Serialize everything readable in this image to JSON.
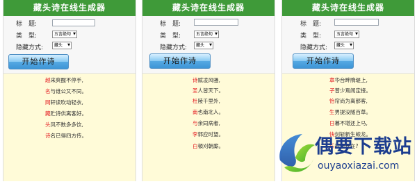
{
  "app_title": "藏头诗在线生成器",
  "form": {
    "title_label": "标　题:",
    "type_label": "类　型:",
    "hide_label": "隐藏方式:",
    "type_value": "五言绝句",
    "hide_value": "藏头",
    "submit_label": "开始作诗"
  },
  "panels": [
    {
      "lines": [
        {
          "head": "越",
          "rest": "来爽醒不停手,"
        },
        {
          "head": "名",
          "rest": "与谁公又不同。"
        },
        {
          "head": "网",
          "rest": "轩读吹动轻衣,"
        },
        {
          "head": "藏",
          "rest": "贮诗供离客好。"
        },
        {
          "head": "头",
          "rest": "风不数多多饮,"
        },
        {
          "head": "诗",
          "rest": "名已得四方传。"
        }
      ]
    },
    {
      "lines": [
        {
          "head": "诗",
          "rest": "赋凌风骚,"
        },
        {
          "head": "圣",
          "rest": "人皆天下。"
        },
        {
          "head": "杜",
          "rest": "陵千里外,"
        },
        {
          "head": "南",
          "rest": "也南北人。"
        },
        {
          "head": "与",
          "rest": "余同病者,"
        },
        {
          "head": "李",
          "rest": "郭应时望。"
        },
        {
          "head": "白",
          "rest": "頓刈朝廝。"
        }
      ]
    },
    {
      "lines": [
        {
          "head": "章",
          "rest": "华台畔隋堤上,"
        },
        {
          "head": "子",
          "rest": "普少焉闻定接。"
        },
        {
          "head": "怡",
          "rest": "帘尚为离那客,"
        },
        {
          "head": "生",
          "rest": "男提没随百草。"
        },
        {
          "head": "日",
          "rest": "暮不堪还上马,"
        },
        {
          "head": "快",
          "rest": "剑斩新生蛟龙。"
        },
        {
          "head": "乐",
          "rest": "欲长安在?"
        }
      ]
    }
  ],
  "watermark": {
    "name": "偶要下载站",
    "url": "ouyaoxiazai.com"
  },
  "colors": {
    "title_bar": "#3f9a39",
    "poem_bg": "#fffbd8",
    "head_char": "#e3151b",
    "button": "#55a9e3",
    "watermark_text": "#1c3d8f"
  }
}
